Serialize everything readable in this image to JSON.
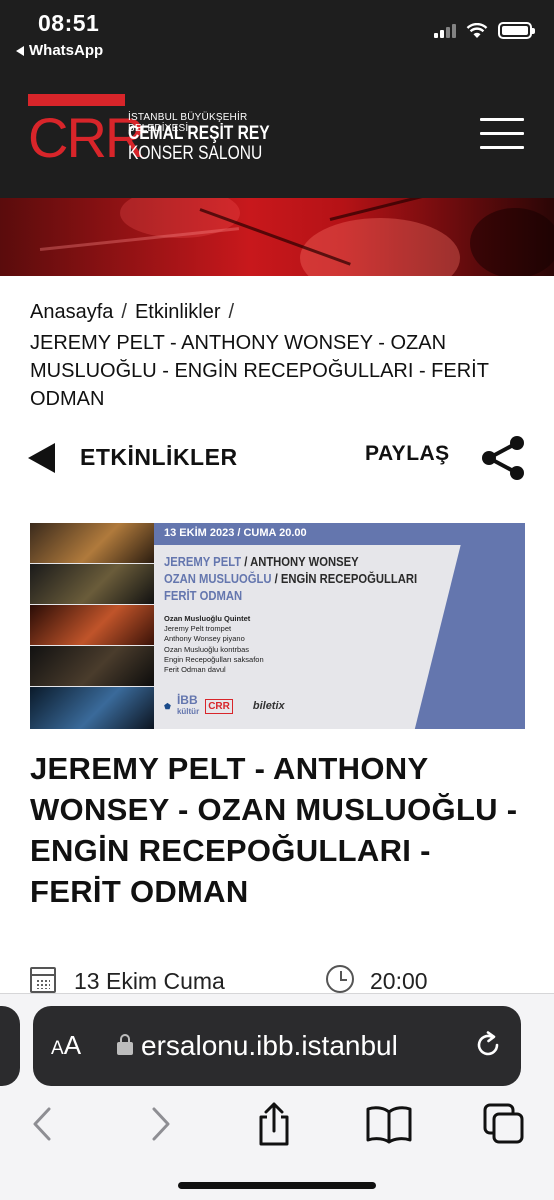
{
  "status_bar": {
    "time": "08:51",
    "back_app": "WhatsApp",
    "icons": [
      "cellular-signal-icon",
      "wifi-icon",
      "battery-icon"
    ]
  },
  "site_header": {
    "logo": {
      "mark": "CRR",
      "line1": "İSTANBUL BÜYÜKŞEHİR BELEDİYESİ",
      "line2": "CEMAL REŞİT REY",
      "line3": "KONSER SALONU"
    },
    "menu_icon": "hamburger-menu-icon",
    "colors": {
      "background": "#1e1e1e",
      "brand_red": "#d8252a"
    }
  },
  "breadcrumb": {
    "home": "Anasayfa",
    "section": "Etkinlikler",
    "separator": "/",
    "current": "JEREMY PELT - ANTHONY WONSEY - OZAN MUSLUOĞLU - ENGİN RECEPOĞULLARI - FERİT ODMAN"
  },
  "actions": {
    "back_label": "ETKİNLİKLER",
    "share_label": "PAYLAŞ"
  },
  "poster": {
    "date_line": "13 EKİM 2023  /  CUMA 20.00",
    "name_line1_a": "JEREMY PELT",
    "name_line1_b": " / ANTHONY WONSEY",
    "name_line2_a": "OZAN MUSLUOĞLU",
    "name_line2_b": " / ENGİN RECEPOĞULLARI",
    "name_line3": "FERİT ODMAN",
    "lineup": [
      "Ozan Musluoğlu Quintet",
      "Jeremy Pelt trompet",
      "Anthony Wonsey piyano",
      "Ozan Musluoğlu kontrbas",
      "Engin Recepoğulları saksafon",
      "Ferit Odman davul"
    ],
    "logos": {
      "ibb": "İBB",
      "kultur": "kültür",
      "crr": "CRR",
      "biletix": "biletix"
    },
    "colors": {
      "band": "#6476ae",
      "background": "#e6e6ea"
    }
  },
  "event": {
    "title": "JEREMY PELT - ANTHONY WONSEY - OZAN MUSLUOĞLU - ENGİN RECEPOĞULLARI - FERİT ODMAN",
    "date": "13 Ekim Cuma",
    "time": "20:00"
  },
  "safari": {
    "text_size_label": "AA",
    "url": "ersalonu.ibb.istanbul",
    "icons": [
      "back-icon",
      "forward-icon",
      "share-icon",
      "bookmarks-icon",
      "tabs-icon",
      "reload-icon",
      "lock-icon"
    ]
  }
}
